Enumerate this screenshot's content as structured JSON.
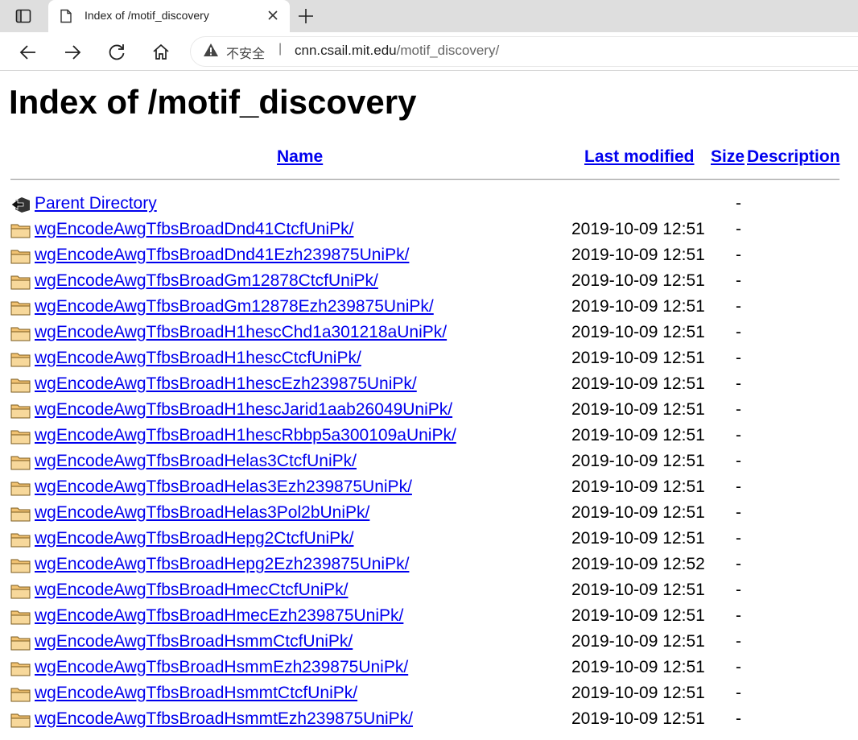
{
  "browser": {
    "tab_title": "Index of /motif_discovery",
    "security_label": "不安全",
    "separator": "|",
    "url_host": "cnn.csail.mit.edu",
    "url_path": "/motif_discovery/"
  },
  "page": {
    "heading": "Index of /motif_discovery",
    "columns": {
      "name": "Name",
      "last_modified": "Last modified",
      "size": "Size",
      "description": "Description"
    },
    "parent": {
      "label": "Parent Directory",
      "size": "-"
    },
    "entries": [
      {
        "name": "wgEncodeAwgTfbsBroadDnd41CtcfUniPk/",
        "modified": "2019-10-09 12:51",
        "size": "-"
      },
      {
        "name": "wgEncodeAwgTfbsBroadDnd41Ezh239875UniPk/",
        "modified": "2019-10-09 12:51",
        "size": "-"
      },
      {
        "name": "wgEncodeAwgTfbsBroadGm12878CtcfUniPk/",
        "modified": "2019-10-09 12:51",
        "size": "-"
      },
      {
        "name": "wgEncodeAwgTfbsBroadGm12878Ezh239875UniPk/",
        "modified": "2019-10-09 12:51",
        "size": "-"
      },
      {
        "name": "wgEncodeAwgTfbsBroadH1hescChd1a301218aUniPk/",
        "modified": "2019-10-09 12:51",
        "size": "-"
      },
      {
        "name": "wgEncodeAwgTfbsBroadH1hescCtcfUniPk/",
        "modified": "2019-10-09 12:51",
        "size": "-"
      },
      {
        "name": "wgEncodeAwgTfbsBroadH1hescEzh239875UniPk/",
        "modified": "2019-10-09 12:51",
        "size": "-"
      },
      {
        "name": "wgEncodeAwgTfbsBroadH1hescJarid1aab26049UniPk/",
        "modified": "2019-10-09 12:51",
        "size": "-"
      },
      {
        "name": "wgEncodeAwgTfbsBroadH1hescRbbp5a300109aUniPk/",
        "modified": "2019-10-09 12:51",
        "size": "-"
      },
      {
        "name": "wgEncodeAwgTfbsBroadHelas3CtcfUniPk/",
        "modified": "2019-10-09 12:51",
        "size": "-"
      },
      {
        "name": "wgEncodeAwgTfbsBroadHelas3Ezh239875UniPk/",
        "modified": "2019-10-09 12:51",
        "size": "-"
      },
      {
        "name": "wgEncodeAwgTfbsBroadHelas3Pol2bUniPk/",
        "modified": "2019-10-09 12:51",
        "size": "-"
      },
      {
        "name": "wgEncodeAwgTfbsBroadHepg2CtcfUniPk/",
        "modified": "2019-10-09 12:51",
        "size": "-"
      },
      {
        "name": "wgEncodeAwgTfbsBroadHepg2Ezh239875UniPk/",
        "modified": "2019-10-09 12:52",
        "size": "-"
      },
      {
        "name": "wgEncodeAwgTfbsBroadHmecCtcfUniPk/",
        "modified": "2019-10-09 12:51",
        "size": "-"
      },
      {
        "name": "wgEncodeAwgTfbsBroadHmecEzh239875UniPk/",
        "modified": "2019-10-09 12:51",
        "size": "-"
      },
      {
        "name": "wgEncodeAwgTfbsBroadHsmmCtcfUniPk/",
        "modified": "2019-10-09 12:51",
        "size": "-"
      },
      {
        "name": "wgEncodeAwgTfbsBroadHsmmEzh239875UniPk/",
        "modified": "2019-10-09 12:51",
        "size": "-"
      },
      {
        "name": "wgEncodeAwgTfbsBroadHsmmtCtcfUniPk/",
        "modified": "2019-10-09 12:51",
        "size": "-"
      },
      {
        "name": "wgEncodeAwgTfbsBroadHsmmtEzh239875UniPk/",
        "modified": "2019-10-09 12:51",
        "size": "-"
      }
    ]
  },
  "colors": {
    "link": "#0000ee",
    "tabbar": "#dedede"
  },
  "icons": {
    "sidebar": "sidebar-toggle-icon",
    "page": "page-icon",
    "close": "close-icon",
    "new_tab": "plus-icon",
    "back": "back-arrow-icon",
    "forward": "forward-arrow-icon",
    "reload": "reload-icon",
    "home": "home-icon",
    "warning": "warning-icon",
    "parent": "back-folder-icon",
    "folder": "folder-icon"
  }
}
